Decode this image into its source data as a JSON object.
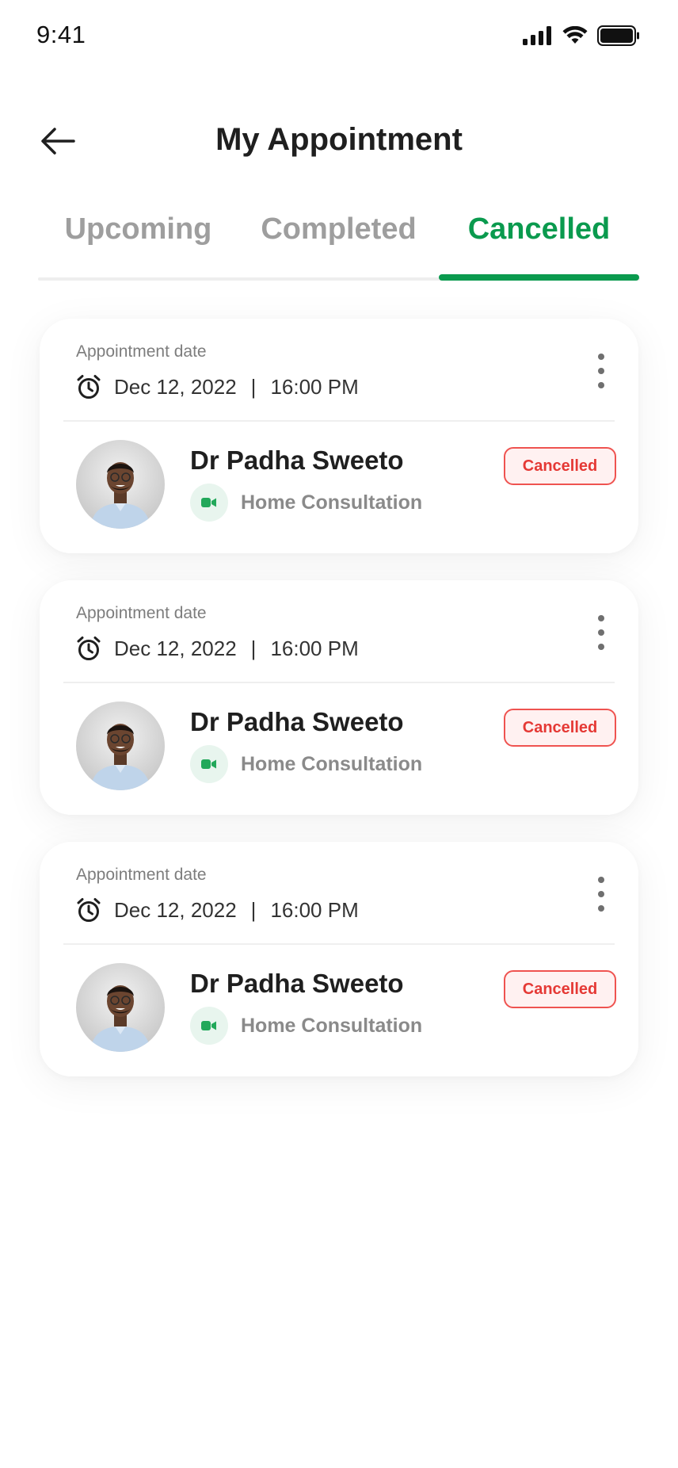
{
  "status_bar": {
    "time": "9:41"
  },
  "header": {
    "title": "My Appointment"
  },
  "tabs": [
    {
      "label": "Upcoming",
      "active": false
    },
    {
      "label": "Completed",
      "active": false
    },
    {
      "label": "Cancelled",
      "active": true
    }
  ],
  "appointments": [
    {
      "date_label": "Appointment date",
      "date": "Dec 12, 2022",
      "separator": "|",
      "time": "16:00 PM",
      "doctor": "Dr Padha Sweeto",
      "consultation": "Home Consultation",
      "status": "Cancelled"
    },
    {
      "date_label": "Appointment date",
      "date": "Dec 12, 2022",
      "separator": "|",
      "time": "16:00 PM",
      "doctor": "Dr Padha Sweeto",
      "consultation": "Home Consultation",
      "status": "Cancelled"
    },
    {
      "date_label": "Appointment date",
      "date": "Dec 12, 2022",
      "separator": "|",
      "time": "16:00 PM",
      "doctor": "Dr Padha Sweeto",
      "consultation": "Home Consultation",
      "status": "Cancelled"
    }
  ],
  "colors": {
    "accent": "#0a9a4e",
    "cancelled": "#e53935",
    "muted": "#9e9e9e"
  },
  "icons": {
    "back": "arrow-left-icon",
    "clock": "alarm-clock-icon",
    "more": "more-vertical-icon",
    "video": "video-camera-icon"
  }
}
